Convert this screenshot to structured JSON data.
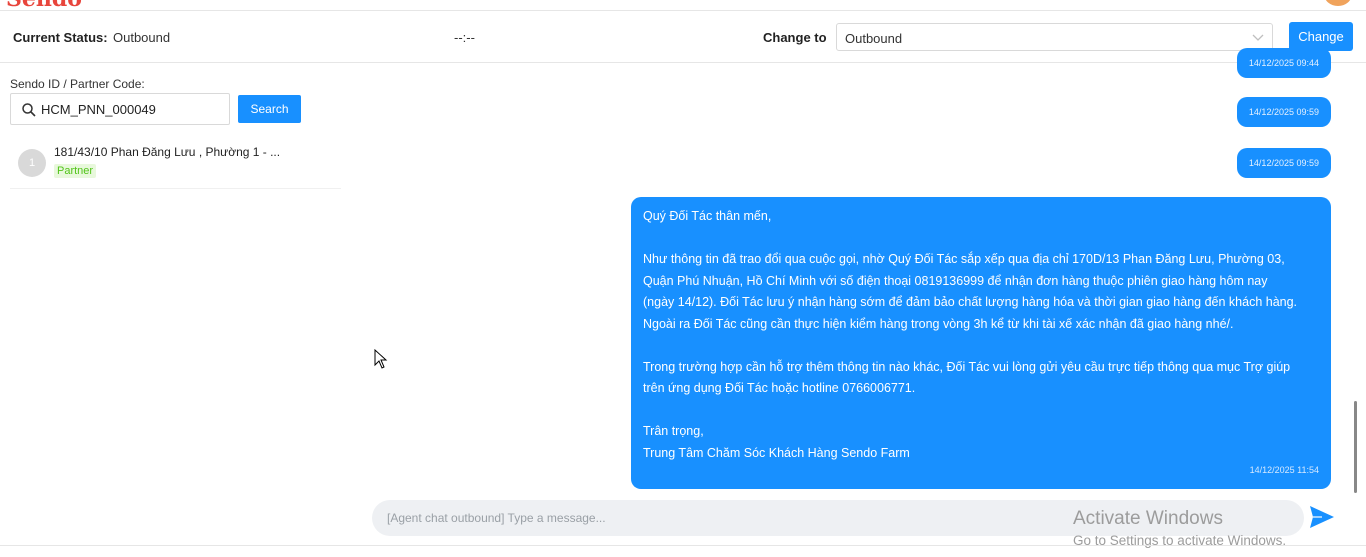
{
  "header": {
    "logo_fragment": "Sendo"
  },
  "status_bar": {
    "current_status_label": "Current Status:",
    "current_status_value": "Outbound",
    "time_value": "--:--",
    "change_to_label": "Change to",
    "change_to_selected": "Outbound",
    "change_button": "Change"
  },
  "search": {
    "label": "Sendo ID / Partner Code:",
    "value": "HCM_PNN_000049",
    "button": "Search"
  },
  "results": [
    {
      "index": "1",
      "address": "181/43/10 Phan Đăng Lưu , Phường 1 - ...",
      "tag": "Partner"
    }
  ],
  "chat": {
    "timestamps": [
      "14/12/2025 09:44",
      "14/12/2025 09:59",
      "14/12/2025 09:59"
    ],
    "message": {
      "greeting": "Quý Đối Tác thân mến,",
      "para1_lines": [
        "Như thông tin đã trao đổi qua cuộc gọi, nhờ Quý Đối Tác sắp xếp qua địa chỉ 170D/13 Phan Đăng Lưu, Phường 03,",
        "Quận Phú Nhuận, Hồ Chí Minh với số điện thoại 0819136999 để nhận đơn hàng thuộc phiên giao hàng hôm nay",
        "(ngày 14/12). Đối Tác lưu ý nhận hàng sớm để đảm bảo chất lượng hàng hóa và thời gian giao hàng đến khách hàng.",
        "Ngoài ra Đối Tác cũng cần thực hiện kiểm hàng trong vòng 3h kể từ khi tài xế xác nhận đã giao hàng nhé/."
      ],
      "para2_lines": [
        "Trong trường hợp cần hỗ trợ thêm thông tin nào khác, Đối Tác vui lòng gửi yêu cầu trực tiếp thông qua mục Trợ giúp",
        "trên ứng dụng Đối Tác hoặc hotline 0766006771."
      ],
      "signoff": "Trân trọng,",
      "signature": "Trung Tâm Chăm Sóc Khách Hàng Sendo Farm",
      "timestamp": "14/12/2025 11:54"
    },
    "input_placeholder": "[Agent chat outbound] Type a message..."
  },
  "watermark": {
    "line1": "Activate Windows",
    "line2": "Go to Settings to activate Windows."
  },
  "colors": {
    "primary": "#1890ff",
    "tag_green": "#52c41a",
    "logo_red": "#e8453c"
  }
}
